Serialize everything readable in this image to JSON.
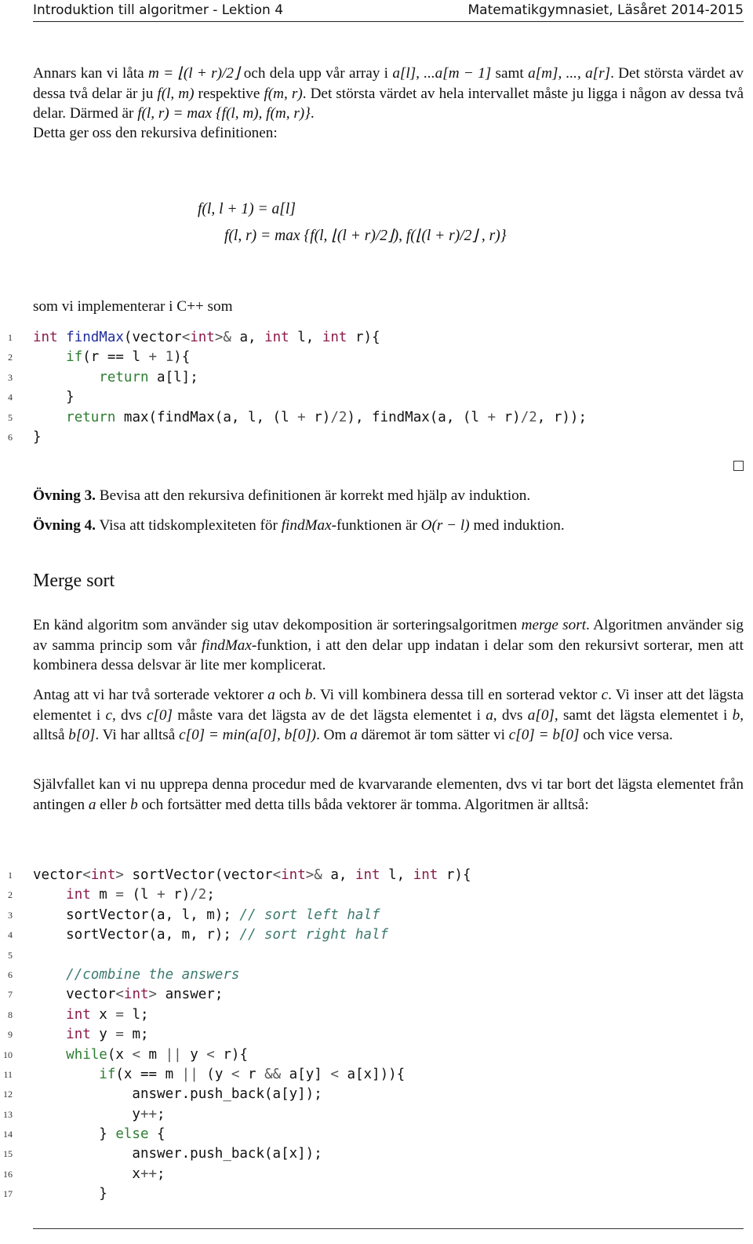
{
  "header": {
    "left": "Introduktion till algoritmer - Lektion 4",
    "right": "Matematikgymnasiet, Läsåret 2014-2015"
  },
  "intro": {
    "p1_html_parts": {
      "a": "Annars kan vi låta ",
      "b": " och dela upp vår array i ",
      "c": " samt ",
      "d": ". Det största värdet av dessa två delar är ju ",
      "e": " respektive ",
      "f": ". Det största värdet av hela intervallet måste ju ligga i någon av dessa två delar. Därmed är ",
      "g": "."
    },
    "p1_math": {
      "m_def": "m = ⌊(l + r)/2⌋",
      "left_range": "a[l], ...a[m − 1]",
      "right_range": "a[m], ..., a[r]",
      "f_lm": "f(l, m)",
      "f_mr": "f(m, r)",
      "f_lr_max": "f(l, r) = max {f(l, m), f(m, r)}"
    },
    "p2": "Detta ger oss den rekursiva definitionen:"
  },
  "definition": {
    "eq1": "f(l, l + 1) = a[l]",
    "eq2": "f(l, r) = max {f(l, ⌊(l + r)/2⌋), f(⌊(l + r)/2⌋ , r)}"
  },
  "impl_text": "som vi implementerar i C++ som",
  "code1": {
    "lines": [
      {
        "n": "1",
        "html": "<span class=\"kw\">int</span> <span class=\"fn\">findMax</span>(vector<span class=\"op\">&lt;</span><span class=\"kw\">int</span><span class=\"op\">&gt;&amp;</span> a, <span class=\"kw\">int</span> l, <span class=\"kw\">int</span> r){"
      },
      {
        "n": "2",
        "html": "    <span class=\"ct\">if</span>(r == l <span class=\"op\">+</span> <span class=\"op\">1</span>){"
      },
      {
        "n": "3",
        "html": "        <span class=\"ct\">return</span> a[l];"
      },
      {
        "n": "4",
        "html": "    }"
      },
      {
        "n": "5",
        "html": "    <span class=\"ct\">return</span> max(findMax(a, l, (l <span class=\"op\">+</span> r)<span class=\"op\">/2</span>), findMax(a, (l <span class=\"op\">+</span> r)<span class=\"op\">/2</span>, r));"
      },
      {
        "n": "6",
        "html": "}"
      }
    ]
  },
  "exercises": [
    {
      "label": "Övning 3.",
      "text": "Bevisa att den rekursiva definitionen är korrekt med hjälp av induktion."
    },
    {
      "label": "Övning 4.",
      "text_a": "Visa att tidskomplexiteten för ",
      "math": "findMax",
      "text_b": "-funktionen är ",
      "math2": "O(r − l)",
      "text_c": " med induktion."
    }
  ],
  "section_title": "Merge sort",
  "merge": {
    "p1": {
      "a": "En känd algoritm som använder sig utav dekomposition är sorteringsalgoritmen ",
      "em": "merge sort",
      "b": ". Algoritmen använder sig av samma princip som vår ",
      "math": "findMax",
      "c": "-funktion, i att den delar upp indatan i delar som den rekursivt sorterar, men att kombinera dessa delsvar är lite mer komplicerat."
    },
    "p2": {
      "a": "Antag att vi har två sorterade vektorer ",
      "va": "a",
      "b": " och ",
      "vb": "b",
      "c": ". Vi vill kombinera dessa till en sorterad vektor ",
      "vc": "c",
      "d": ". Vi inser att det lägsta elementet i ",
      "vc2": "c",
      "e": ", dvs ",
      "c0": "c[0]",
      "f": " måste vara det lägsta av de det lägsta elementet i ",
      "va2": "a",
      "g": ", dvs ",
      "a0": "a[0]",
      "h": ", samt det lägsta elementet i ",
      "vb2": "b",
      "i": ", alltså ",
      "b0": "b[0]",
      "j": ". Vi har alltså ",
      "minexpr": "c[0] = min(a[0], b[0])",
      "k": ". Om ",
      "va3": "a",
      "l": " däremot är tom sätter vi ",
      "cb": "c[0] = b[0]",
      "m": " och vice versa."
    },
    "p3": {
      "a": "Självfallet kan vi nu upprepa denna procedur med de kvarvarande elementen, dvs vi tar bort det lägsta elementet från antingen ",
      "va": "a",
      "b": " eller ",
      "vb": "b",
      "c": " och fortsätter med detta tills båda vektorer är tomma. Algoritmen är alltså:"
    }
  },
  "code2": {
    "lines": [
      {
        "n": "1",
        "html": "vector<span class=\"op\">&lt;</span><span class=\"kw\">int</span><span class=\"op\">&gt;</span> sortVector(vector<span class=\"op\">&lt;</span><span class=\"kw\">int</span><span class=\"op\">&gt;&amp;</span> a, <span class=\"kw\">int</span> l, <span class=\"kw\">int</span> r){"
      },
      {
        "n": "2",
        "html": "    <span class=\"kw\">int</span> m <span class=\"op\">=</span> (l <span class=\"op\">+</span> r)<span class=\"op\">/2</span>;"
      },
      {
        "n": "3",
        "html": "    sortVector(a, l, m); <span class=\"cm\">// sort left half</span>"
      },
      {
        "n": "4",
        "html": "    sortVector(a, m, r); <span class=\"cm\">// sort right half</span>"
      },
      {
        "n": "5",
        "html": ""
      },
      {
        "n": "6",
        "html": "    <span class=\"cm\">//combine the answers</span>"
      },
      {
        "n": "7",
        "html": "    vector<span class=\"op\">&lt;</span><span class=\"kw\">int</span><span class=\"op\">&gt;</span> answer;"
      },
      {
        "n": "8",
        "html": "    <span class=\"kw\">int</span> x <span class=\"op\">=</span> l;"
      },
      {
        "n": "9",
        "html": "    <span class=\"kw\">int</span> y <span class=\"op\">=</span> m;"
      },
      {
        "n": "10",
        "html": "    <span class=\"ct\">while</span>(x <span class=\"op\">&lt;</span> m <span class=\"op\">||</span> y <span class=\"op\">&lt;</span> r){"
      },
      {
        "n": "11",
        "html": "        <span class=\"ct\">if</span>(x == m <span class=\"op\">||</span> (y <span class=\"op\">&lt;</span> r <span class=\"op\">&amp;&amp;</span> a[y] <span class=\"op\">&lt;</span> a[x])){"
      },
      {
        "n": "12",
        "html": "            answer.push_back(a[y]);"
      },
      {
        "n": "13",
        "html": "            y<span class=\"op\">++</span>;"
      },
      {
        "n": "14",
        "html": "        } <span class=\"ct\">else</span> {"
      },
      {
        "n": "15",
        "html": "            answer.push_back(a[x]);"
      },
      {
        "n": "16",
        "html": "            x<span class=\"op\">++</span>;"
      },
      {
        "n": "17",
        "html": "        }"
      }
    ]
  },
  "colors": {
    "keyword_type": "#8b1a4a",
    "keyword_control": "#2e7d32",
    "function_name": "#1f2d9c",
    "comment": "#3d7a6e"
  }
}
